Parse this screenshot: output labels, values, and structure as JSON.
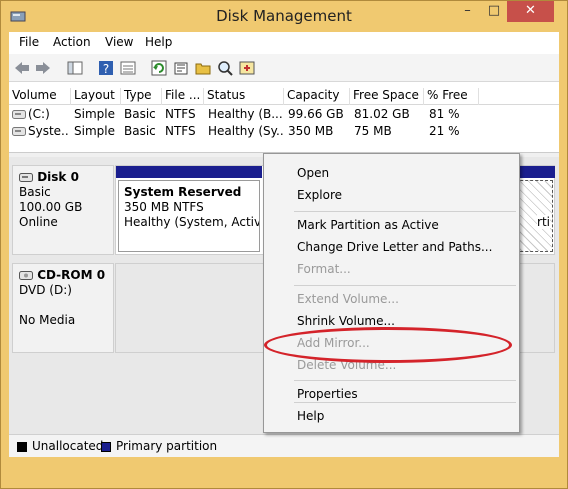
{
  "window": {
    "title": "Disk Management",
    "controls": {
      "minimize": "–",
      "maximize": "□",
      "close": "✕"
    }
  },
  "menu": [
    "File",
    "Action",
    "View",
    "Help"
  ],
  "toolbar": [
    "back-arrow-icon",
    "forward-arrow-icon",
    "console-tree-icon",
    "help-icon",
    "details-icon",
    "refresh-icon",
    "properties-icon",
    "open-folder-icon",
    "search-icon",
    "export-icon"
  ],
  "volume_table": {
    "headers": [
      "Volume",
      "Layout",
      "Type",
      "File ...",
      "Status",
      "Capacity",
      "Free Space",
      "% Free"
    ],
    "rows": [
      [
        "(C:)",
        "Simple",
        "Basic",
        "NTFS",
        "Healthy (B...",
        "99.66 GB",
        "81.02 GB",
        "81 %"
      ],
      [
        "Syste...",
        "Simple",
        "Basic",
        "NTFS",
        "Healthy (Sy...",
        "350 MB",
        "75 MB",
        "21 %"
      ]
    ]
  },
  "disks": [
    {
      "name": "Disk 0",
      "type": "Basic",
      "size": "100.00 GB",
      "state": "Online"
    },
    {
      "name": "CD-ROM 0",
      "type": "DVD (D:)",
      "state": "No Media"
    }
  ],
  "partition": {
    "name": "System Reserved",
    "size": "350 MB NTFS",
    "status": "Healthy (System, Active,"
  },
  "partition2_fragment": "rti",
  "legend": [
    {
      "label": "Unallocated",
      "color": "#000000"
    },
    {
      "label": "Primary partition",
      "color": "#1a1e8e"
    }
  ],
  "context_menu": {
    "open": "Open",
    "explore": "Explore",
    "mark_active": "Mark Partition as Active",
    "change_letter": "Change Drive Letter and Paths...",
    "format": "Format...",
    "extend": "Extend Volume...",
    "shrink": "Shrink Volume...",
    "add_mirror": "Add Mirror...",
    "delete": "Delete Volume...",
    "properties": "Properties",
    "help": "Help"
  },
  "highlight_color": "#d4232a"
}
